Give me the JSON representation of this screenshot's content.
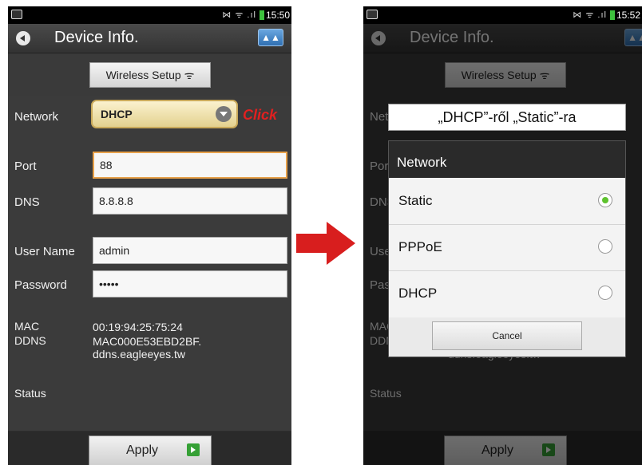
{
  "status_bar": {
    "left_time": "15:50",
    "right_time": "15:52",
    "icons": "⋈ ᯤ .ıl"
  },
  "app": {
    "title": "Device Info.",
    "wireless_setup": "Wireless Setup  ᯤ"
  },
  "form": {
    "network_label": "Network",
    "network_value": "DHCP",
    "click_label": "Click",
    "port_label": "Port",
    "port_value": "88",
    "dns_label": "DNS",
    "dns_value": "8.8.8.8",
    "username_label": "User Name",
    "username_value": "admin",
    "password_label": "Password",
    "password_value": "•••••",
    "mac_label": "MAC",
    "mac_value": "00:19:94:25:75:24",
    "ddns_label": "DDNS",
    "ddns_value_1": "MAC000E53EBD2BF.",
    "ddns_value_2": "ddns.eagleeyes.tw",
    "status_label": "Status"
  },
  "apply_label": "Apply",
  "caption": "„DHCP”-ről „Static”-ra",
  "dialog": {
    "title": "Network",
    "options": [
      {
        "label": "Static",
        "selected": true
      },
      {
        "label": "PPPoE",
        "selected": false
      },
      {
        "label": "DHCP",
        "selected": false
      }
    ],
    "cancel": "Cancel"
  },
  "colors": {
    "arrow": "#d81e1e",
    "click": "#e02020",
    "radio_on": "#5ec22e"
  }
}
